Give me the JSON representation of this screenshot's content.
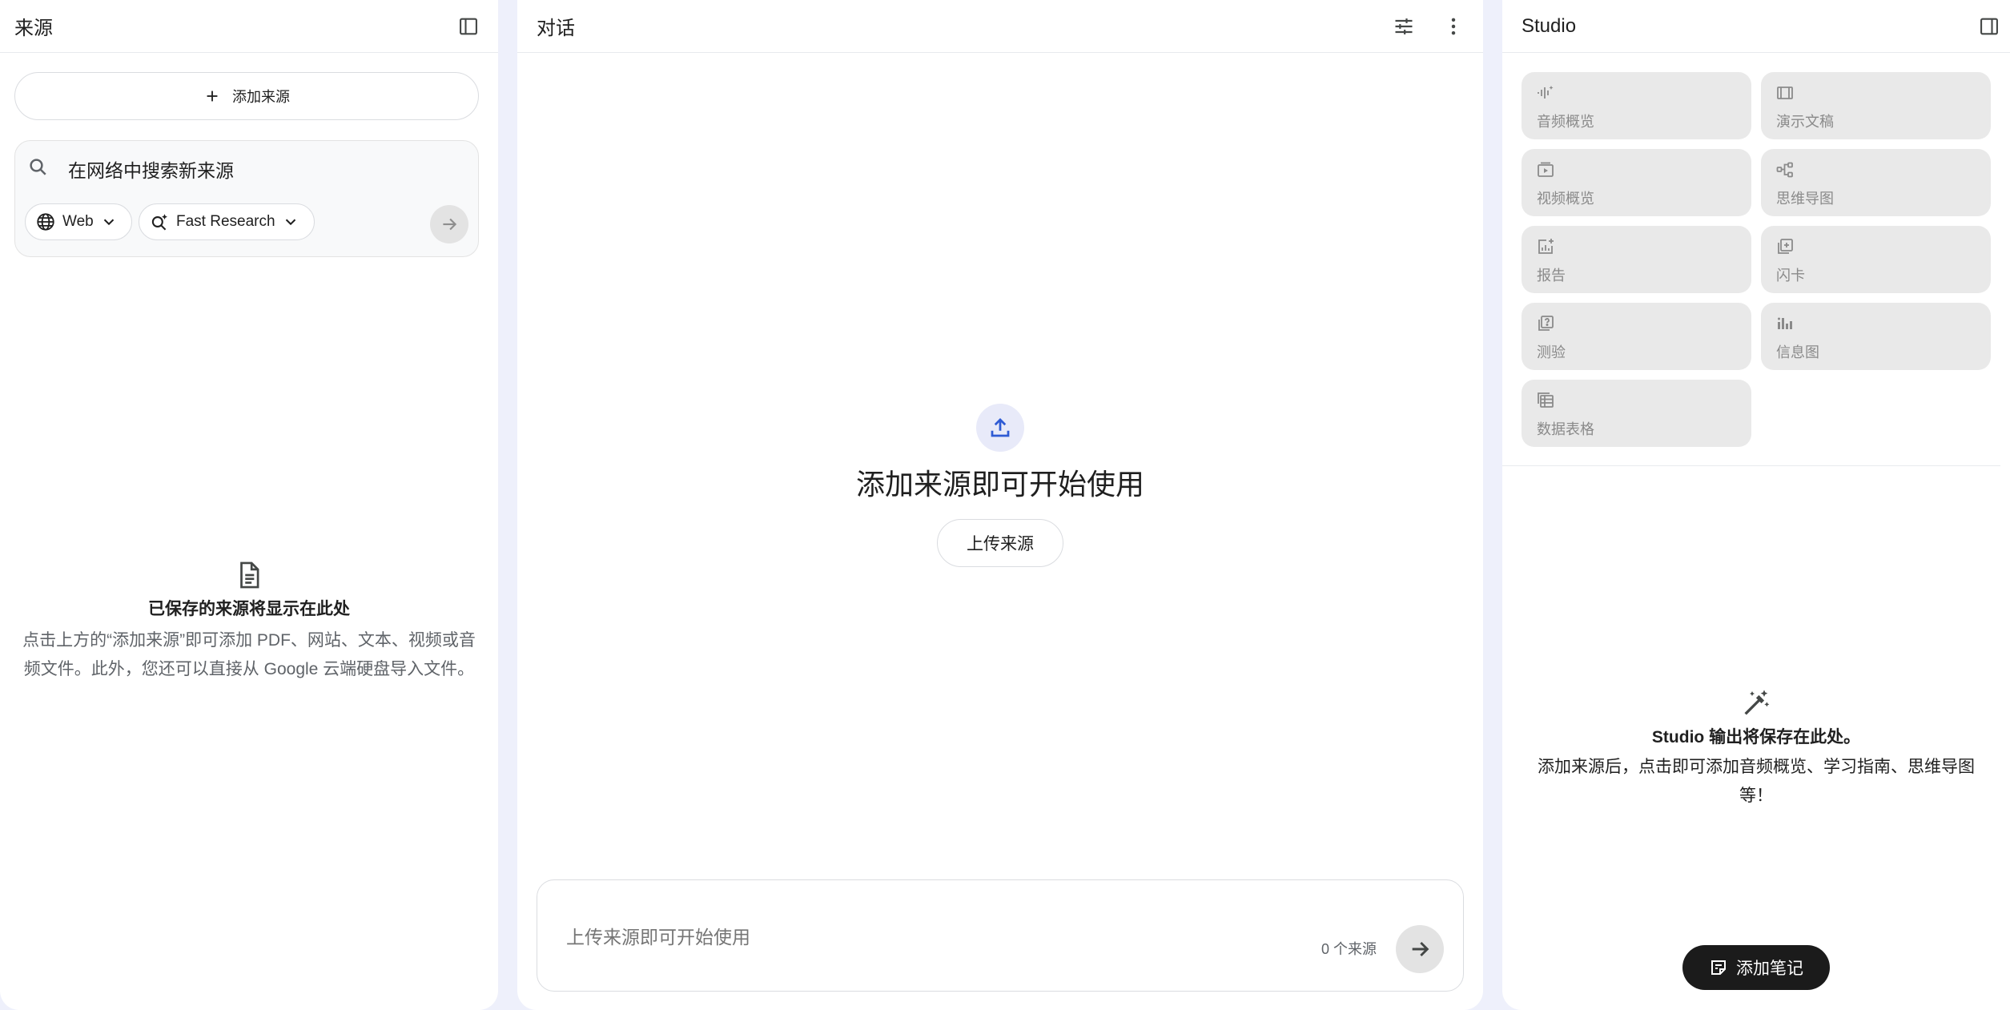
{
  "sources": {
    "title": "来源",
    "add_source_label": "添加来源",
    "search_placeholder": "在网络中搜索新来源",
    "web_chip_label": "Web",
    "research_chip_label": "Fast Research",
    "empty_title": "已保存的来源将显示在此处",
    "empty_desc": "点击上方的“添加来源”即可添加 PDF、网站、文本、视频或音频文件。此外，您还可以直接从 Google 云端硬盘导入文件。"
  },
  "chat": {
    "title": "对话",
    "empty_title": "添加来源即可开始使用",
    "upload_label": "上传来源",
    "input_placeholder": "上传来源即可开始使用",
    "source_count": "0 个来源"
  },
  "studio": {
    "title": "Studio",
    "tiles": [
      {
        "label": "音频概览",
        "icon": "audio-waveform-icon"
      },
      {
        "label": "演示文稿",
        "icon": "slides-icon"
      },
      {
        "label": "视频概览",
        "icon": "video-icon"
      },
      {
        "label": "思维导图",
        "icon": "mindmap-icon"
      },
      {
        "label": "报告",
        "icon": "report-icon"
      },
      {
        "label": "闪卡",
        "icon": "flashcards-icon"
      },
      {
        "label": "测验",
        "icon": "quiz-icon"
      },
      {
        "label": "信息图",
        "icon": "infographic-icon"
      },
      {
        "label": "数据表格",
        "icon": "table-icon"
      }
    ],
    "empty_title": "Studio 输出将保存在此处。",
    "empty_desc": "添加来源后，点击即可添加音频概览、学习指南、思维导图等！",
    "add_note_label": "添加笔记"
  }
}
